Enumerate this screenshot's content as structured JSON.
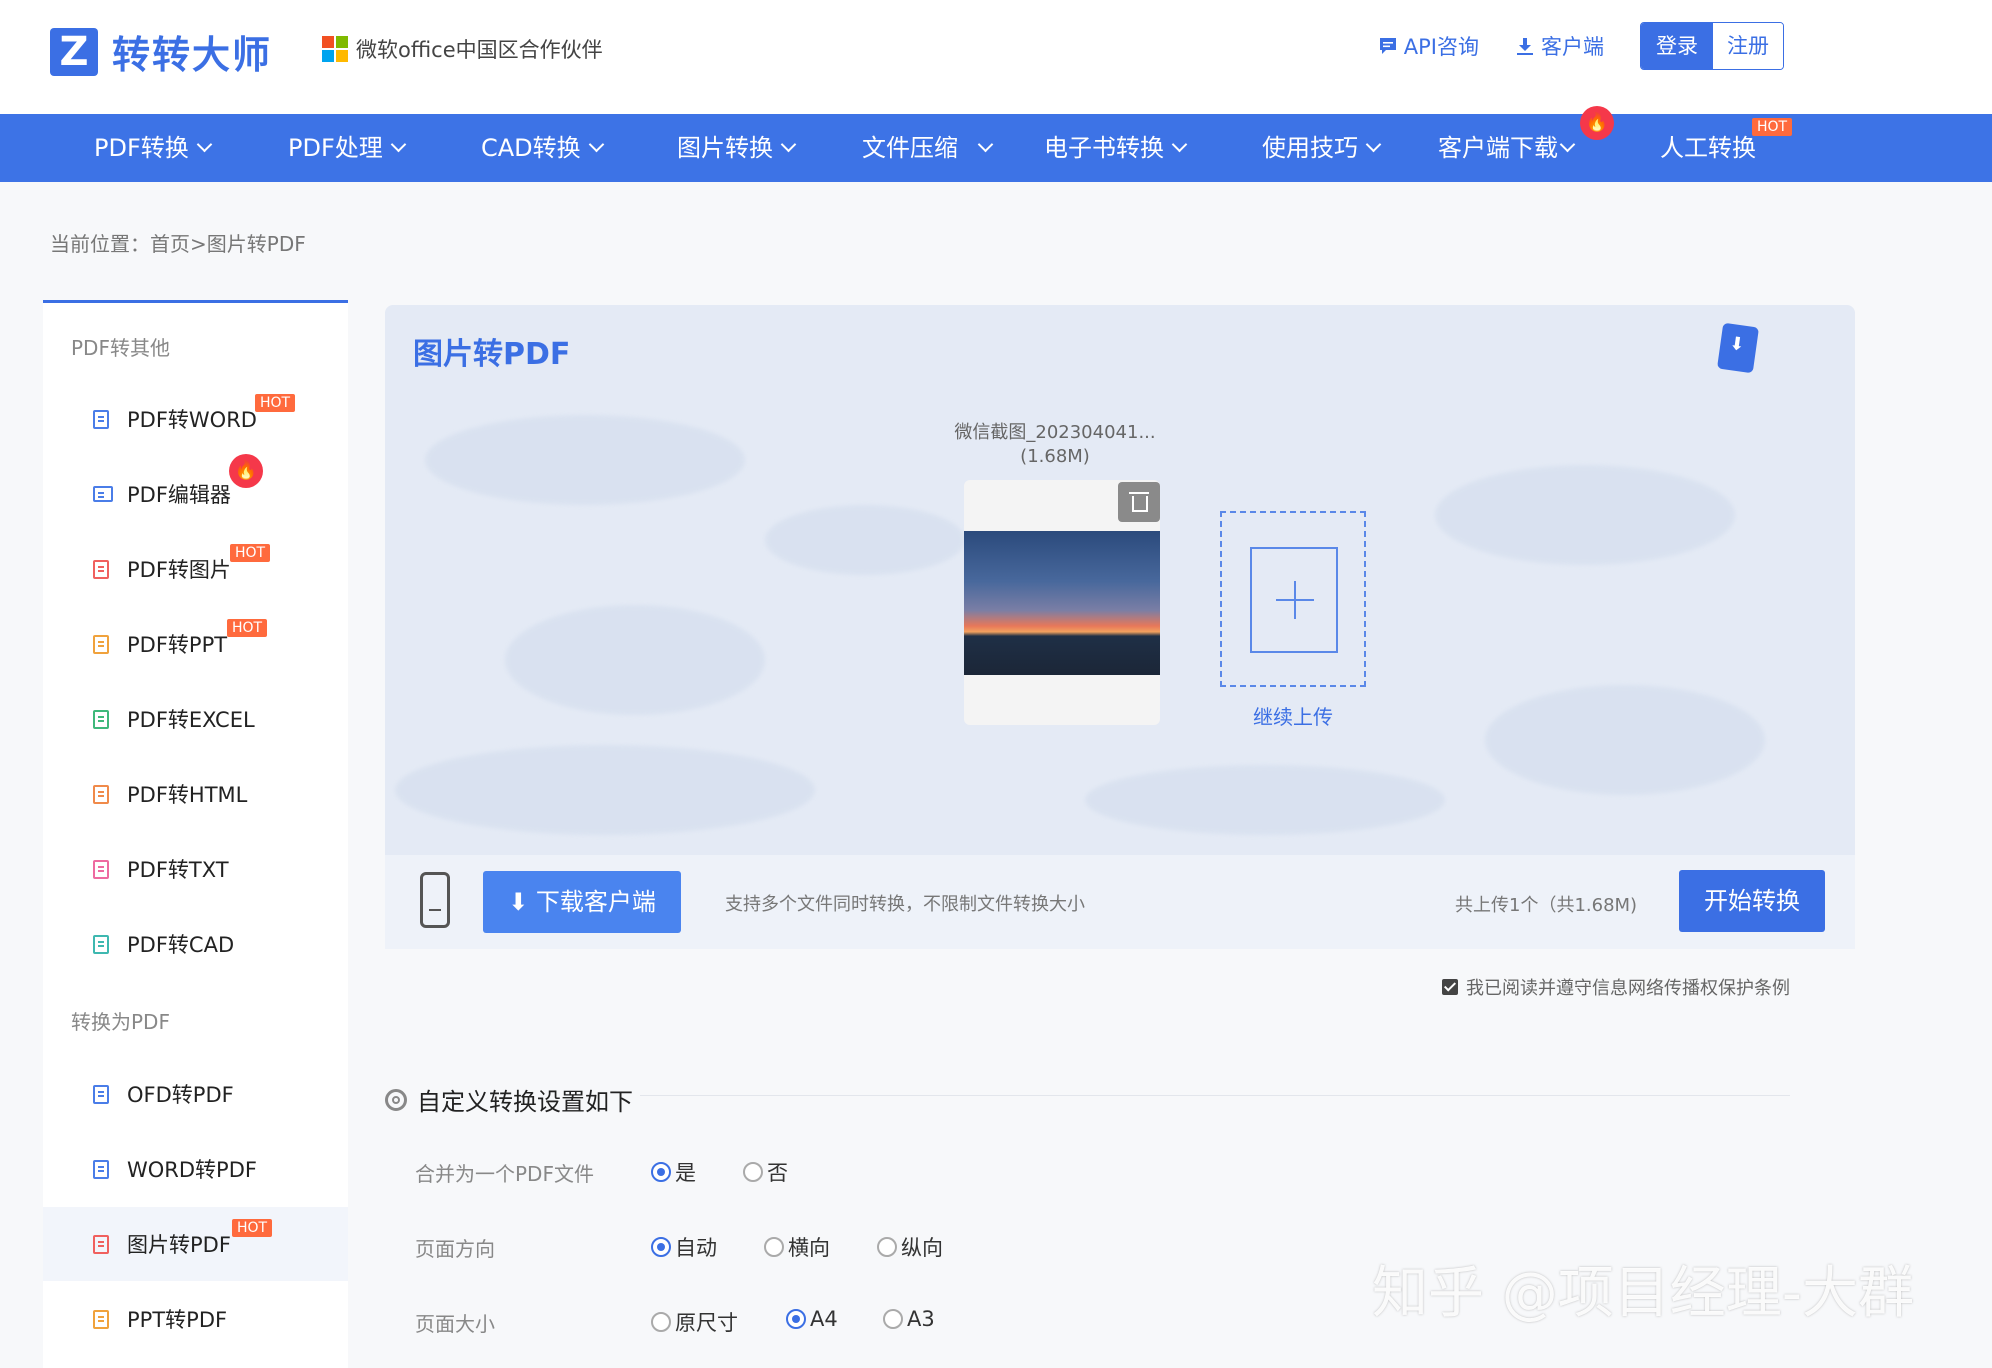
{
  "header": {
    "logo_mark": "Z",
    "logo_text": "转转大师",
    "partner_text": "微软office中国区合作伙伴",
    "api_label": "API咨询",
    "client_label": "客户端",
    "login_label": "登录",
    "register_label": "注册"
  },
  "nav": {
    "items": [
      {
        "label": "PDF转换"
      },
      {
        "label": "PDF处理"
      },
      {
        "label": "CAD转换"
      },
      {
        "label": "图片转换"
      },
      {
        "label": "文件压缩"
      },
      {
        "label": "电子书转换"
      },
      {
        "label": "使用技巧"
      },
      {
        "label": "客户端下载"
      },
      {
        "label": "人工转换"
      }
    ],
    "hot_badge": "HOT"
  },
  "breadcrumb": "当前位置：首页>图片转PDF",
  "sidebar": {
    "group1": "PDF转其他",
    "group2": "转换为PDF",
    "items": [
      {
        "label": "PDF转WORD",
        "badge": "HOT"
      },
      {
        "label": "PDF编辑器"
      },
      {
        "label": "PDF转图片",
        "badge": "HOT"
      },
      {
        "label": "PDF转PPT",
        "badge": "HOT"
      },
      {
        "label": "PDF转EXCEL"
      },
      {
        "label": "PDF转HTML"
      },
      {
        "label": "PDF转TXT"
      },
      {
        "label": "PDF转CAD"
      },
      {
        "label": "OFD转PDF"
      },
      {
        "label": "WORD转PDF"
      },
      {
        "label": "图片转PDF",
        "badge": "HOT"
      },
      {
        "label": "PPT转PDF"
      }
    ]
  },
  "upload": {
    "title": "图片转PDF",
    "file_name": "微信截图_202304041...",
    "file_size": "(1.68M)",
    "continue_label": "继续上传"
  },
  "action_bar": {
    "download_label": "下载客户端",
    "support_text": "支持多个文件同时转换，不限制文件转换大小",
    "count_text": "共上传1个（共1.68M)",
    "start_label": "开始转换"
  },
  "agree_text": "我已阅读并遵守信息网络传播权保护条例",
  "settings": {
    "title": "自定义转换设置如下",
    "merge": {
      "label": "合并为一个PDF文件",
      "options": [
        "是",
        "否"
      ],
      "selected": "是"
    },
    "orientation": {
      "label": "页面方向",
      "options": [
        "自动",
        "横向",
        "纵向"
      ],
      "selected": "自动"
    },
    "size": {
      "label": "页面大小",
      "options": [
        "原尺寸",
        "A4",
        "A3"
      ],
      "selected": "A4"
    }
  },
  "watermark": "知乎 @项目经理-大群",
  "colors": {
    "brand": "#3b6fe4",
    "nav": "#3d73e6",
    "hot": "#ff6a3d",
    "fire": "#f5384a"
  }
}
